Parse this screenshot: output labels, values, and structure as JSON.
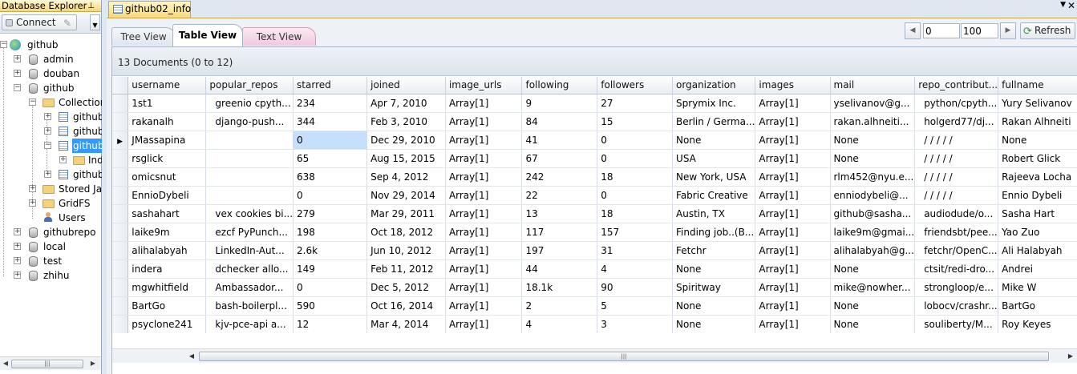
{
  "explorer": {
    "title": "Database Explorer",
    "pin_icon": "pin-icon",
    "connect_label": "Connect"
  },
  "tree": {
    "server": "github",
    "databases": [
      "admin",
      "douban",
      "github",
      "githubrepo",
      "local",
      "test",
      "zhihu"
    ],
    "collections_folder": "Collections",
    "collections": [
      "github",
      "github",
      "github",
      "github"
    ],
    "indexes_folder": "Indexes",
    "stored_folder": "Stored JavaScript",
    "gridfs_folder": "GridFS",
    "users_label": "Users"
  },
  "document_tab": {
    "label": "github02_info"
  },
  "view_tabs": {
    "tree": "Tree View",
    "table": "Table View",
    "text": "Text View"
  },
  "pager": {
    "start": "0",
    "limit": "100",
    "refresh_label": "Refresh"
  },
  "grid": {
    "summary": "13 Documents (0 to 12)",
    "columns": [
      "username",
      "popular_repos",
      "starred",
      "joined",
      "image_urls",
      "following",
      "followers",
      "organization",
      "images",
      "mail",
      "repo_contribut...",
      "fullname"
    ],
    "rows": [
      [
        "1st1",
        "greenio cpyth...",
        "234",
        "Apr 7, 2010",
        "Array[1]",
        "9",
        "27",
        "Sprymix Inc.",
        "Array[1]",
        "yselivanov@g...",
        "python/cpyth...",
        "Yury Selivanov"
      ],
      [
        "rakanalh",
        "django-push...",
        "344",
        "Feb 3, 2010",
        "Array[1]",
        "84",
        "15",
        "Berlin / Germa...",
        "Array[1]",
        "rakan.alhneiti...",
        "holgerd77/dj...",
        "Rakan Alhneiti"
      ],
      [
        "JMassapina",
        "",
        "0",
        "Dec 29, 2010",
        "Array[1]",
        "41",
        "0",
        "None",
        "Array[1]",
        "None",
        "/ / / / /",
        "None"
      ],
      [
        "rsglick",
        "",
        "65",
        "Aug 15, 2015",
        "Array[1]",
        "67",
        "0",
        "USA",
        "Array[1]",
        "None",
        "/ / / / /",
        "Robert Glick"
      ],
      [
        "omicsnut",
        "",
        "638",
        "Sep 4, 2012",
        "Array[1]",
        "242",
        "18",
        "New York, USA",
        "Array[1]",
        "rlm452@nyu.e...",
        "/ / / / /",
        "Rajeeva Locha"
      ],
      [
        "EnnioDybeli",
        "",
        "0",
        "Nov 29, 2014",
        "Array[1]",
        "22",
        "0",
        "Fabric Creative",
        "Array[1]",
        "enniodybeli@...",
        "/ / / / /",
        "Ennio Dybeli"
      ],
      [
        "sashahart",
        "vex cookies bi...",
        "279",
        "Mar 29, 2011",
        "Array[1]",
        "13",
        "18",
        "Austin, TX",
        "Array[1]",
        "github@sasha...",
        "audiodude/o...",
        "Sasha Hart"
      ],
      [
        "laike9m",
        "ezcf PyPunch...",
        "198",
        "Oct 18, 2012",
        "Array[1]",
        "117",
        "157",
        "Finding job..(B...",
        "Array[1]",
        "laike9m@gmai...",
        "friendsbt/pee...",
        "Yao Zuo"
      ],
      [
        "alihalabyah",
        "LinkedIn-Aut...",
        "2.6k",
        "Jun 10, 2012",
        "Array[1]",
        "197",
        "31",
        "Fetchr",
        "Array[1]",
        "alihalabyah@g...",
        "fetchr/OpenC...",
        "Ali Halabyah"
      ],
      [
        "indera",
        "dchecker allo...",
        "149",
        "Feb 11, 2012",
        "Array[1]",
        "44",
        "4",
        "None",
        "Array[1]",
        "None",
        "ctsit/redi-dro...",
        "Andrei"
      ],
      [
        "mgwhitfield",
        "Ambassador...",
        "0",
        "Dec 5, 2012",
        "Array[1]",
        "18.1k",
        "90",
        "Spiritway",
        "Array[1]",
        "mike@nowher...",
        "strongloop/e...",
        "Mike W"
      ],
      [
        "BartGo",
        "bash-boilerpl...",
        "590",
        "Oct 16, 2014",
        "Array[1]",
        "2",
        "5",
        "None",
        "Array[1]",
        "None",
        "lobocv/crashr...",
        "BartGo"
      ],
      [
        "psyclone241",
        "kjv-pce-api a...",
        "12",
        "Mar 4, 2014",
        "Array[1]",
        "4",
        "3",
        "None",
        "Array[1]",
        "None",
        "souliberty/M...",
        "Roy Keyes"
      ]
    ],
    "current_row": 2,
    "selected_cell": [
      2,
      2
    ],
    "selection_color": "#c6e0fb"
  }
}
